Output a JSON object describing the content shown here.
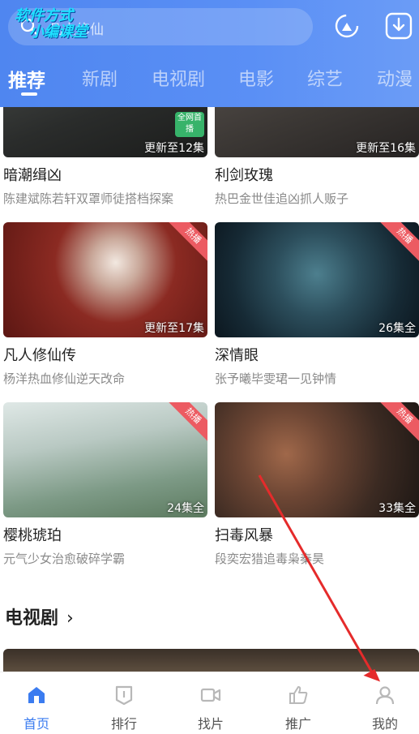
{
  "header": {
    "search_hint": "凡人修仙",
    "watermark_line1": "软件方式",
    "watermark_line2": "小编课堂",
    "tabs": [
      "推荐",
      "新剧",
      "电视剧",
      "电影",
      "综艺",
      "动漫"
    ]
  },
  "cards": [
    {
      "title": "暗潮缉凶",
      "subtitle": "陈建斌陈若轩双罩师徒搭档探案",
      "episodes": "更新至12集",
      "badge": "全网首播",
      "hot": ""
    },
    {
      "title": "利剑玫瑰",
      "subtitle": "热巴金世佳追凶抓人贩子",
      "episodes": "更新至16集",
      "badge": "",
      "hot": ""
    },
    {
      "title": "凡人修仙传",
      "subtitle": "杨洋热血修仙逆天改命",
      "episodes": "更新至17集",
      "badge": "",
      "hot": "热播"
    },
    {
      "title": "深情眼",
      "subtitle": "张予曦毕雯珺一见钟情",
      "episodes": "26集全",
      "badge": "",
      "hot": "热播"
    },
    {
      "title": "樱桃琥珀",
      "subtitle": "元气少女治愈破碎学霸",
      "episodes": "24集全",
      "badge": "",
      "hot": "热播"
    },
    {
      "title": "扫毒风暴",
      "subtitle": "段奕宏猎追毒枭秦昊",
      "episodes": "33集全",
      "badge": "",
      "hot": "热播"
    }
  ],
  "section": {
    "title": "电视剧",
    "chevron": "›"
  },
  "bottom_nav": [
    {
      "label": "首页",
      "icon": "home-icon"
    },
    {
      "label": "排行",
      "icon": "ranking-icon"
    },
    {
      "label": "找片",
      "icon": "video-camera-icon"
    },
    {
      "label": "推广",
      "icon": "thumbs-up-icon"
    },
    {
      "label": "我的",
      "icon": "user-icon"
    }
  ],
  "colors": {
    "accent": "#3b7cf0",
    "header": "#5a8ff5",
    "ribbon": "#ec5b62"
  }
}
